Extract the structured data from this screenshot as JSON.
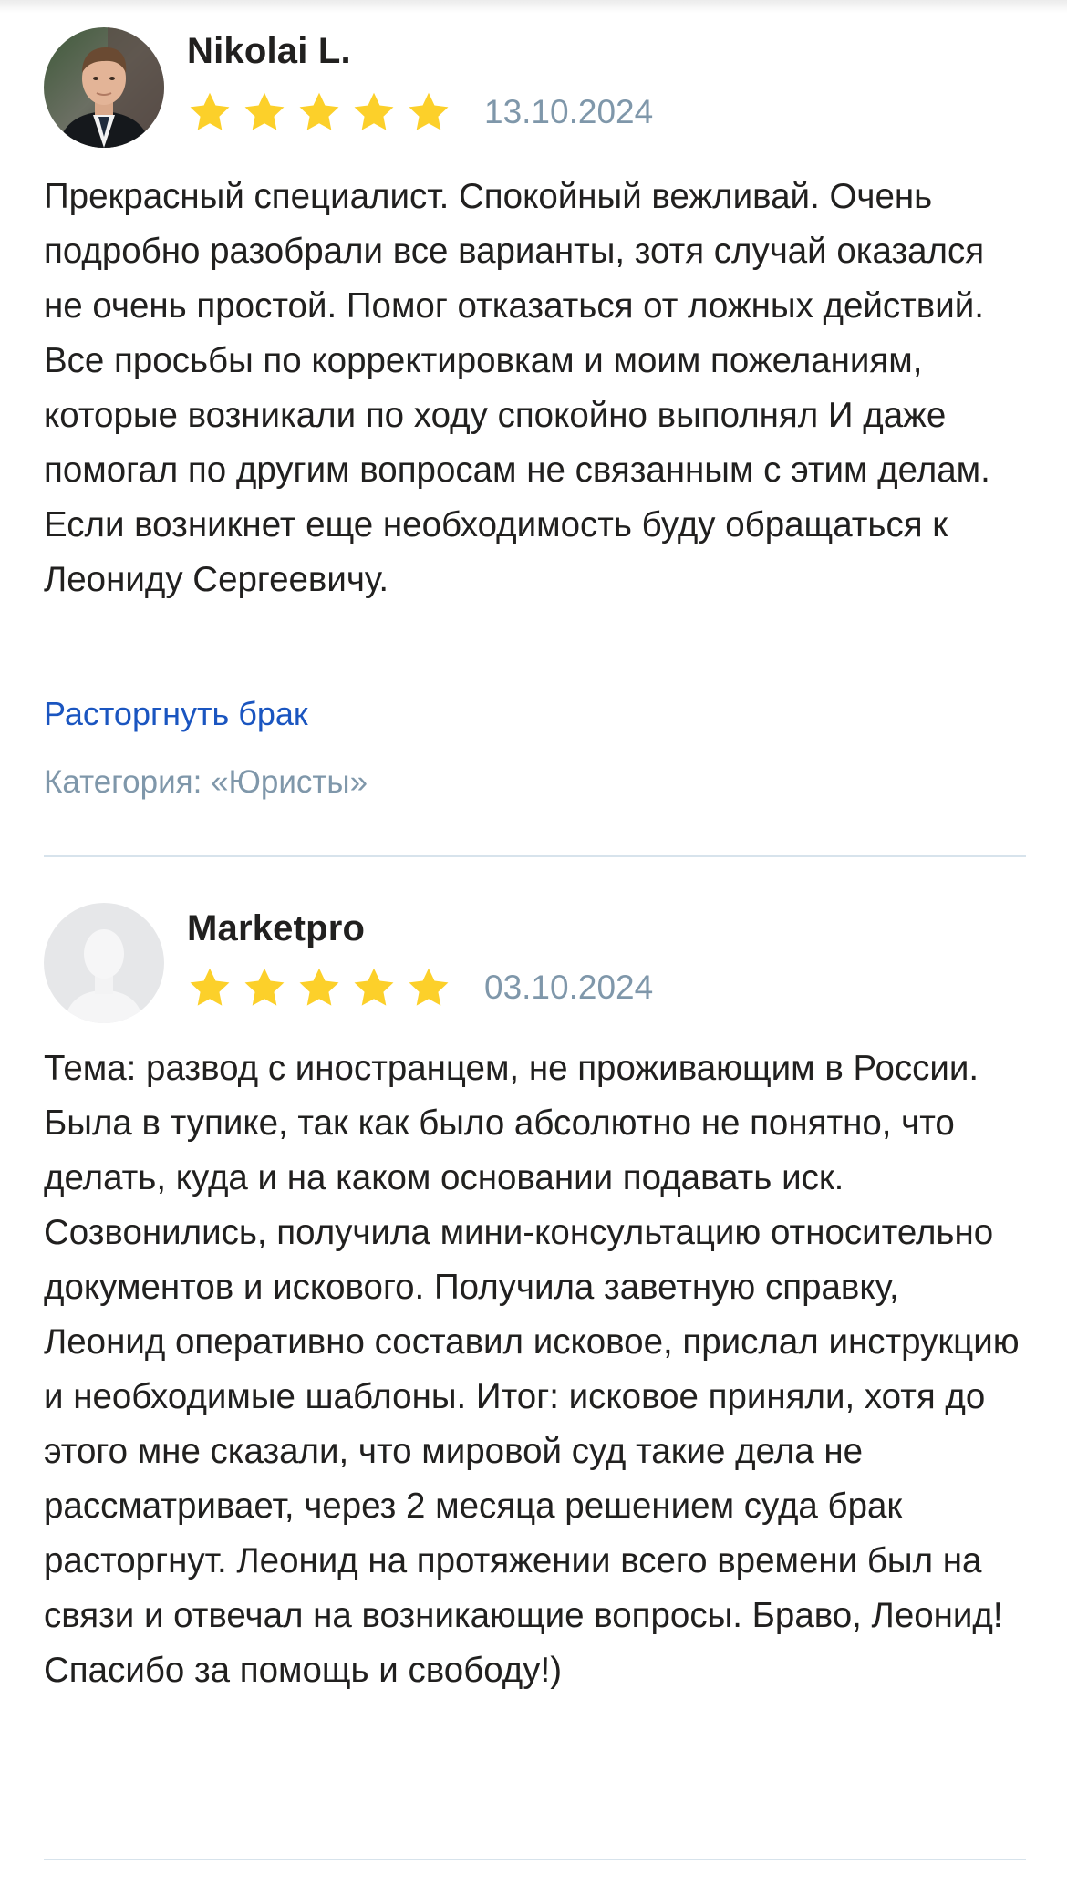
{
  "reviews": [
    {
      "author": "Nikolai L.",
      "avatar": "photo-avatar",
      "rating": 5,
      "date": "13.10.2024",
      "text": "Прекрасный специалист. Спокойный вежливай. Очень подробно разобрали все варианты, зотя случай оказался не очень простой. Помог отказаться от ложных действий. Все просьбы по корректировкам и моим пожеланиям, которые возникали по ходу спокойно выполнял И даже помогал по другим вопросам не связанным с этим делам. Если возникнет еще необходимость буду обращаться к Леониду Сергеевичу.",
      "tag": "Расторгнуть брак",
      "category": "Категория: «Юристы»"
    },
    {
      "author": "Marketpro",
      "avatar": "default-user-silhouette-icon",
      "rating": 5,
      "date": "03.10.2024",
      "text": "Тема: развод с иностранцем, не проживающим в России. Была в тупике, так как было абсолютно не понятно, что делать, куда и на каком основании подавать иск. Созвонились, получила мини-консультацию относительно документов и искового. Получила заветную справку, Леонид оперативно составил исковое, прислал инструкцию и необходимые шаблоны. Итог: исковое приняли, хотя до этого мне сказали, что мировой суд такие дела не рассматривает, через 2 месяца решением суда брак расторгнут. Леонид на протяжении всего времени был на связи и отвечал на возникающие вопросы. Браво, Леонид! Спасибо за помощь и свободу!)"
    }
  ],
  "colors": {
    "star": "#fcd02a",
    "link": "#1a55c0",
    "muted": "#7f97aa",
    "divider": "#d7e3ec",
    "text": "#21201f"
  }
}
